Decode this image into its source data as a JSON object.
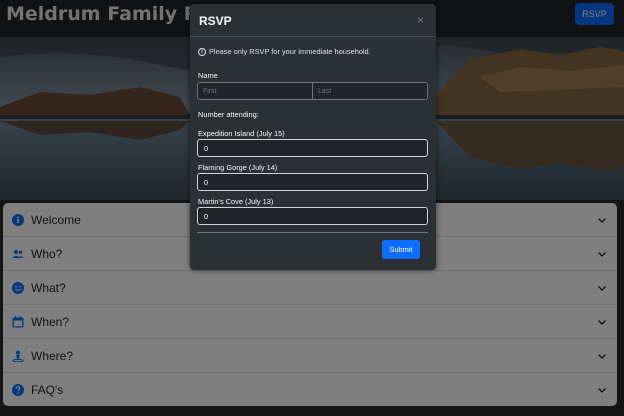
{
  "navbar": {
    "title": "Meldrum Family Reunion",
    "rsvp_label": "RSVP"
  },
  "hero": {
    "description_icon": "landscape-lake-reflection"
  },
  "accordion": {
    "items": [
      {
        "label": "Welcome",
        "icon": "info-circle-icon"
      },
      {
        "label": "Who?",
        "icon": "people-icon"
      },
      {
        "label": "What?",
        "icon": "smile-icon"
      },
      {
        "label": "When?",
        "icon": "calendar-icon"
      },
      {
        "label": "Where?",
        "icon": "person-pin-icon"
      },
      {
        "label": "FAQ's",
        "icon": "question-circle-icon"
      }
    ]
  },
  "modal": {
    "title": "RSVP",
    "close": "×",
    "notice": "Please only RSVP for your immediate household.",
    "name_label": "Name",
    "first_placeholder": "First",
    "last_placeholder": "Last",
    "attending_label": "Number attending:",
    "events": [
      {
        "label": "Expedition Island (July 15)",
        "value": "0"
      },
      {
        "label": "Flaming Gorge (July 14)",
        "value": "0"
      },
      {
        "label": "Martin's Cove (July 13)",
        "value": "0"
      }
    ],
    "submit_label": "Submit"
  },
  "colors": {
    "primary": "#0d6efd",
    "modal_bg": "#2b3035",
    "accordion_icon": "#0d6efd"
  }
}
